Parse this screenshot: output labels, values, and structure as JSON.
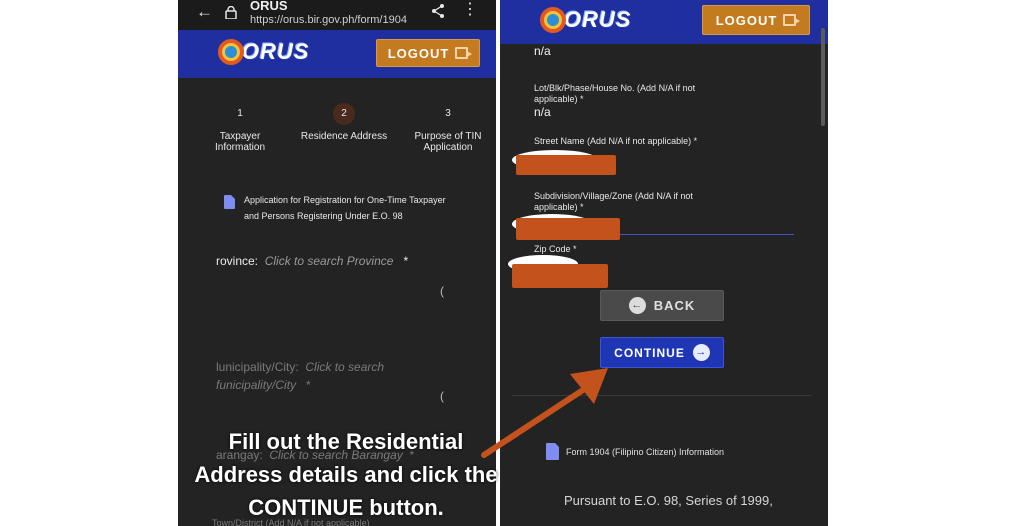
{
  "browser": {
    "title": "ORUS",
    "url": "https://orus.bir.gov.ph/form/1904"
  },
  "brand": {
    "logo_text": "ORUS",
    "logout_label": "LOGOUT",
    "bar_color": "#1f2fa0",
    "logout_color": "#c47a1e"
  },
  "stepper": [
    {
      "num": "1",
      "label": "Taxpayer Information",
      "active": false
    },
    {
      "num": "2",
      "label": "Residence Address",
      "active": true
    },
    {
      "num": "3",
      "label": "Purpose of TIN Application",
      "active": false
    }
  ],
  "left_form": {
    "doc_note": "Application for Registration for One-Time Taxpayer and Persons Registering Under E.O. 98",
    "province_label": "rovince:",
    "province_placeholder": "Click to search Province",
    "province_req": "*",
    "municipality_label": "lunicipality/City:",
    "municipality_placeholder": "Click to search",
    "municipality_line2": "funicipality/City",
    "municipality_req": "*",
    "barangay_label": "arangay:",
    "barangay_placeholder": "Click to search Barangay",
    "barangay_req": "*",
    "paren": "(",
    "bottom_cut": "Town/District (Add N/A if not applicable)"
  },
  "right_form": {
    "top_value": "n/a",
    "lot_label": "Lot/Blk/Phase/House No. (Add N/A if not applicable) *",
    "lot_value": "n/a",
    "street_label": "Street Name (Add N/A if not applicable) *",
    "subdivision_label": "Subdivision/Village/Zone (Add N/A if not applicable) *",
    "zip_label": "Zip Code *",
    "back_label": "BACK",
    "continue_label": "CONTINUE",
    "continue_color": "#1e36b4",
    "form_note": "Form 1904 (Filipino Citizen) Information",
    "pursuant": "Pursuant to E.O. 98, Series of 1999,"
  },
  "caption": {
    "line1": "Fill out the Residential",
    "line2": "Address details and click the",
    "line3": "CONTINUE button.",
    "arrow_color": "#c4521c"
  }
}
